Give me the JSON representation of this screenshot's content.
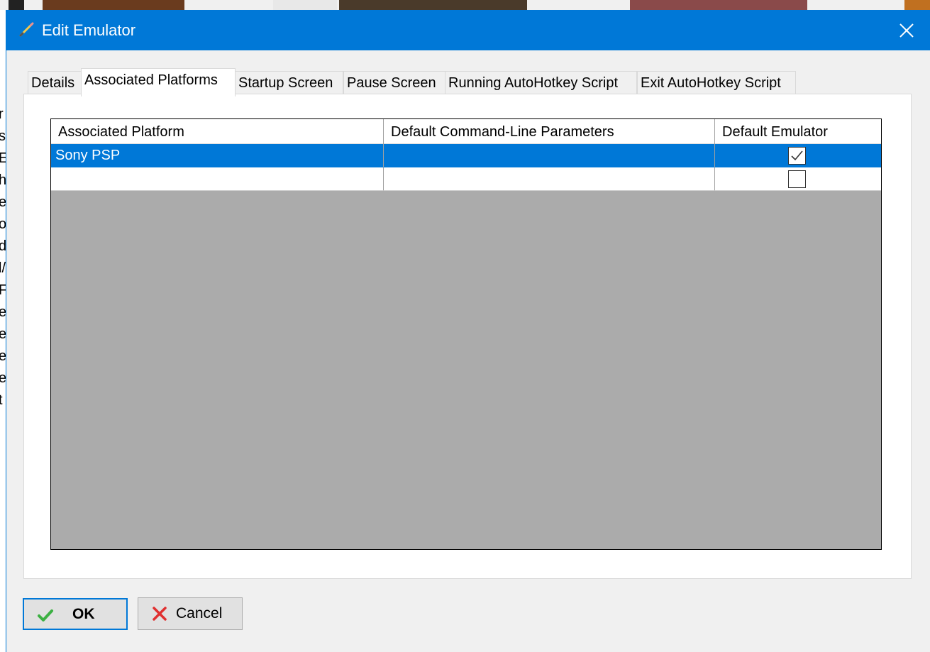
{
  "window": {
    "title": "Edit Emulator"
  },
  "tabs": [
    {
      "label": "Details",
      "active": false
    },
    {
      "label": "Associated Platforms",
      "active": true
    },
    {
      "label": "Startup Screen",
      "active": false
    },
    {
      "label": "Pause Screen",
      "active": false
    },
    {
      "label": "Running AutoHotkey Script",
      "active": false
    },
    {
      "label": "Exit AutoHotkey Script",
      "active": false
    }
  ],
  "grid": {
    "columns": [
      "Associated Platform",
      "Default Command-Line Parameters",
      "Default Emulator"
    ],
    "rows": [
      {
        "platform": "Sony PSP",
        "params": "",
        "default": true,
        "selected": true
      },
      {
        "platform": "",
        "params": "",
        "default": false,
        "selected": false
      }
    ]
  },
  "buttons": {
    "ok_label": "OK",
    "cancel_label": "Cancel"
  },
  "background_left_chars": [
    "r",
    "s",
    "E",
    "h",
    "e",
    "o",
    "d",
    "l/",
    "F",
    "e",
    "e",
    "e",
    "e",
    "t"
  ],
  "colors": {
    "accent": "#0078d7",
    "grid_empty": "#ababab",
    "ok_icon": "#3cb043",
    "cancel_icon": "#e03030"
  }
}
